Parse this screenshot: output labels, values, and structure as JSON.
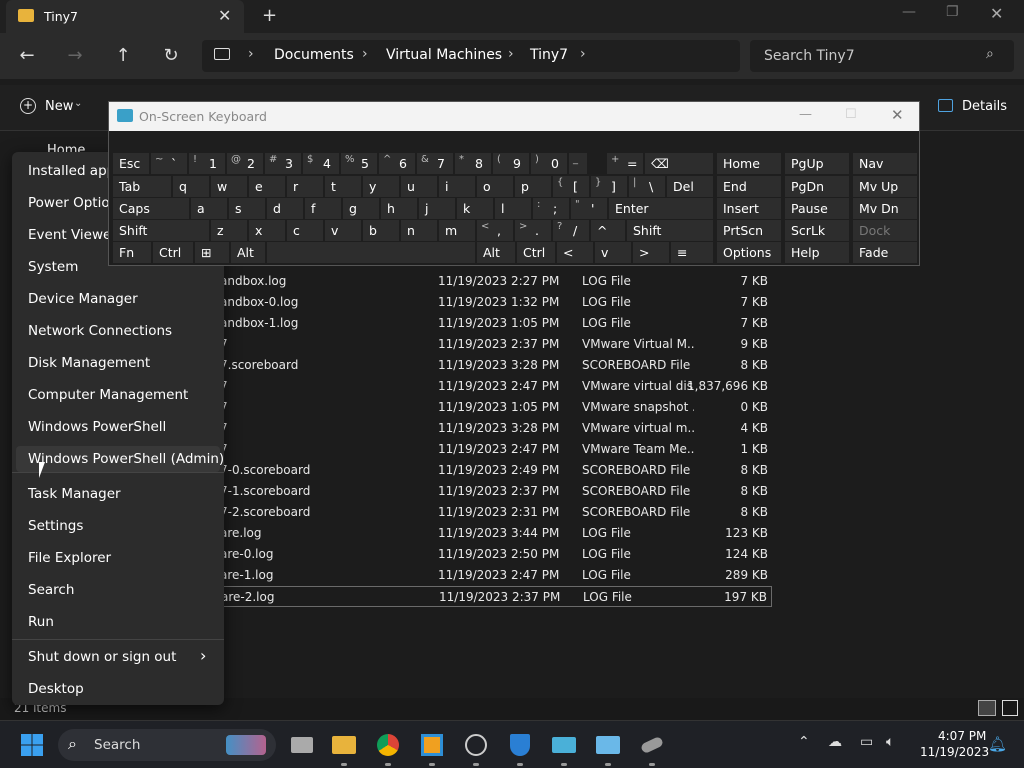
{
  "window": {
    "tab_title": "Tiny7",
    "address": {
      "crumbs": [
        "Documents",
        "Virtual Machines",
        "Tiny7"
      ]
    },
    "search_placeholder": "Search Tiny7",
    "new_label": "New",
    "details_label": "Details",
    "nav_home": "Home"
  },
  "files": [
    {
      "name": "andbox.log",
      "date": "11/19/2023 2:27 PM",
      "type": "LOG File",
      "size": "7 KB"
    },
    {
      "name": "andbox-0.log",
      "date": "11/19/2023 1:32 PM",
      "type": "LOG File",
      "size": "7 KB"
    },
    {
      "name": "andbox-1.log",
      "date": "11/19/2023 1:05 PM",
      "type": "LOG File",
      "size": "7 KB"
    },
    {
      "name": "7",
      "date": "11/19/2023 2:37 PM",
      "type": "VMware Virtual M...",
      "size": "9 KB"
    },
    {
      "name": "7.scoreboard",
      "date": "11/19/2023 3:28 PM",
      "type": "SCOREBOARD File",
      "size": "8 KB"
    },
    {
      "name": "7",
      "date": "11/19/2023 2:47 PM",
      "type": "VMware virtual dis...",
      "size": "1,837,696 KB"
    },
    {
      "name": "7",
      "date": "11/19/2023 1:05 PM",
      "type": "VMware snapshot ...",
      "size": "0 KB"
    },
    {
      "name": "7",
      "date": "11/19/2023 3:28 PM",
      "type": "VMware virtual m...",
      "size": "4 KB"
    },
    {
      "name": "7",
      "date": "11/19/2023 2:47 PM",
      "type": "VMware Team Me...",
      "size": "1 KB"
    },
    {
      "name": "7-0.scoreboard",
      "date": "11/19/2023 2:49 PM",
      "type": "SCOREBOARD File",
      "size": "8 KB"
    },
    {
      "name": "7-1.scoreboard",
      "date": "11/19/2023 2:37 PM",
      "type": "SCOREBOARD File",
      "size": "8 KB"
    },
    {
      "name": "7-2.scoreboard",
      "date": "11/19/2023 2:31 PM",
      "type": "SCOREBOARD File",
      "size": "8 KB"
    },
    {
      "name": "are.log",
      "date": "11/19/2023 3:44 PM",
      "type": "LOG File",
      "size": "123 KB"
    },
    {
      "name": "are-0.log",
      "date": "11/19/2023 2:50 PM",
      "type": "LOG File",
      "size": "124 KB"
    },
    {
      "name": "are-1.log",
      "date": "11/19/2023 2:47 PM",
      "type": "LOG File",
      "size": "289 KB"
    },
    {
      "name": "are-2.log",
      "date": "11/19/2023 2:37 PM",
      "type": "LOG File",
      "size": "197 KB"
    }
  ],
  "status": {
    "items_count": "21 items"
  },
  "menu": {
    "items": [
      "Installed apps",
      "Power Options",
      "Event Viewer",
      "System",
      "Device Manager",
      "Network Connections",
      "Disk Management",
      "Computer Management",
      "Windows PowerShell",
      "Windows PowerShell (Admin)",
      "Task Manager",
      "Settings",
      "File Explorer",
      "Search",
      "Run",
      "Shut down or sign out",
      "Desktop"
    ]
  },
  "osk": {
    "title": "On-Screen Keyboard",
    "rows": [
      [
        [
          "Esc",
          ""
        ],
        [
          "`",
          "~"
        ],
        [
          "1",
          "!"
        ],
        [
          "2",
          "@"
        ],
        [
          "3",
          "#"
        ],
        [
          "4",
          "$"
        ],
        [
          "5",
          "%"
        ],
        [
          "6",
          "^"
        ],
        [
          "7",
          "&"
        ],
        [
          "8",
          "*"
        ],
        [
          "9",
          "("
        ],
        [
          "0",
          ")"
        ],
        [
          "-",
          "_"
        ],
        [
          "=",
          "+"
        ],
        [
          "⌫",
          ""
        ]
      ],
      [
        [
          "Tab",
          ""
        ],
        [
          "q",
          ""
        ],
        [
          "w",
          ""
        ],
        [
          "e",
          ""
        ],
        [
          "r",
          ""
        ],
        [
          "t",
          ""
        ],
        [
          "y",
          ""
        ],
        [
          "u",
          ""
        ],
        [
          "i",
          ""
        ],
        [
          "o",
          ""
        ],
        [
          "p",
          ""
        ],
        [
          "[",
          "{"
        ],
        [
          "]",
          "}"
        ],
        [
          "\\",
          "|"
        ],
        [
          "Del",
          ""
        ]
      ],
      [
        [
          "Caps",
          ""
        ],
        [
          "a",
          ""
        ],
        [
          "s",
          ""
        ],
        [
          "d",
          ""
        ],
        [
          "f",
          ""
        ],
        [
          "g",
          ""
        ],
        [
          "h",
          ""
        ],
        [
          "j",
          ""
        ],
        [
          "k",
          ""
        ],
        [
          "l",
          ""
        ],
        [
          ";",
          ":"
        ],
        [
          "'",
          "\""
        ],
        [
          "Enter",
          ""
        ]
      ],
      [
        [
          "Shift",
          ""
        ],
        [
          "z",
          ""
        ],
        [
          "x",
          ""
        ],
        [
          "c",
          ""
        ],
        [
          "v",
          ""
        ],
        [
          "b",
          ""
        ],
        [
          "n",
          ""
        ],
        [
          "m",
          ""
        ],
        [
          ",",
          "<"
        ],
        [
          ".",
          ">"
        ],
        [
          "/",
          "?"
        ],
        [
          "^",
          ""
        ],
        [
          "Shift",
          ""
        ]
      ],
      [
        [
          "Fn",
          ""
        ],
        [
          "Ctrl",
          ""
        ],
        [
          "⊞",
          ""
        ],
        [
          "Alt",
          ""
        ],
        [
          "",
          ""
        ],
        [
          "Alt",
          ""
        ],
        [
          "Ctrl",
          ""
        ],
        [
          "<",
          ""
        ],
        [
          "v",
          ""
        ],
        [
          ">",
          ""
        ],
        [
          "≡",
          ""
        ]
      ]
    ],
    "nav": [
      [
        "Home",
        "PgUp",
        "Nav"
      ],
      [
        "End",
        "PgDn",
        "Mv Up"
      ],
      [
        "Insert",
        "Pause",
        "Mv Dn"
      ],
      [
        "PrtScn",
        "ScrLk",
        "Dock"
      ],
      [
        "Options",
        "Help",
        "Fade"
      ]
    ]
  },
  "taskbar": {
    "search_label": "Search",
    "time": "4:07 PM",
    "date": "11/19/2023"
  }
}
